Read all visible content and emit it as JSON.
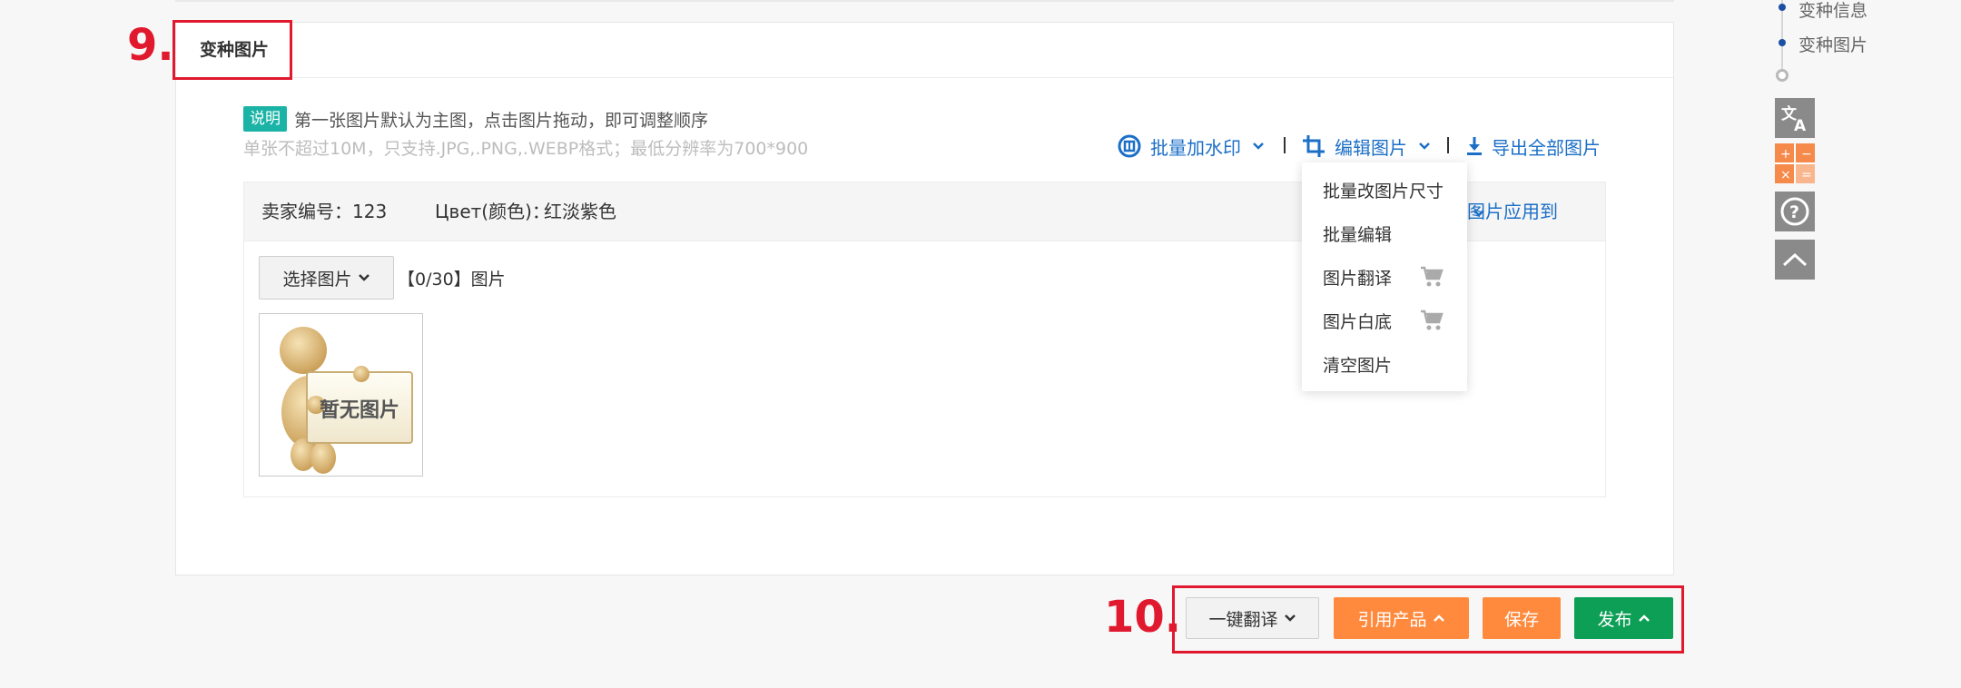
{
  "section": {
    "title": "变种图片",
    "annotation_number": "9."
  },
  "tips": {
    "badge": "说明",
    "line1": "第一张图片默认为主图，点击图片拖动，即可调整顺序",
    "line2": "单张不超过10M，只支持.JPG,.PNG,.WEBP格式；最低分辨率为700*900"
  },
  "toolbar": {
    "watermark": "批量加水印",
    "edit": "编辑图片",
    "export": "导出全部图片"
  },
  "edit_menu": {
    "items": [
      {
        "label": "批量改图片尺寸",
        "cart": false
      },
      {
        "label": "批量编辑",
        "cart": false
      },
      {
        "label": "图片翻译",
        "cart": true
      },
      {
        "label": "图片白底",
        "cart": true
      },
      {
        "label": "清空图片",
        "cart": false
      }
    ]
  },
  "variant": {
    "seller_sku": "卖家编号：123",
    "color_label": "Цвет(颜色)：",
    "color_value": "红淡紫色",
    "apply_to": "图片应用到",
    "select_button": "选择图片",
    "count_text": "【0/30】图片",
    "placeholder_text": "暂无图片"
  },
  "actions": {
    "annotation_number": "10.",
    "translate": "一键翻译",
    "cite_product": "引用产品",
    "save": "保存",
    "publish": "发布"
  },
  "anchors": {
    "items": [
      "变种信息",
      "变种图片"
    ]
  },
  "colors": {
    "link_blue": "#1b6fc7",
    "teal_badge": "#1ab3a6",
    "orange": "#ff8a3d",
    "green": "#0e9f57",
    "annotation_red": "#e0192e"
  }
}
